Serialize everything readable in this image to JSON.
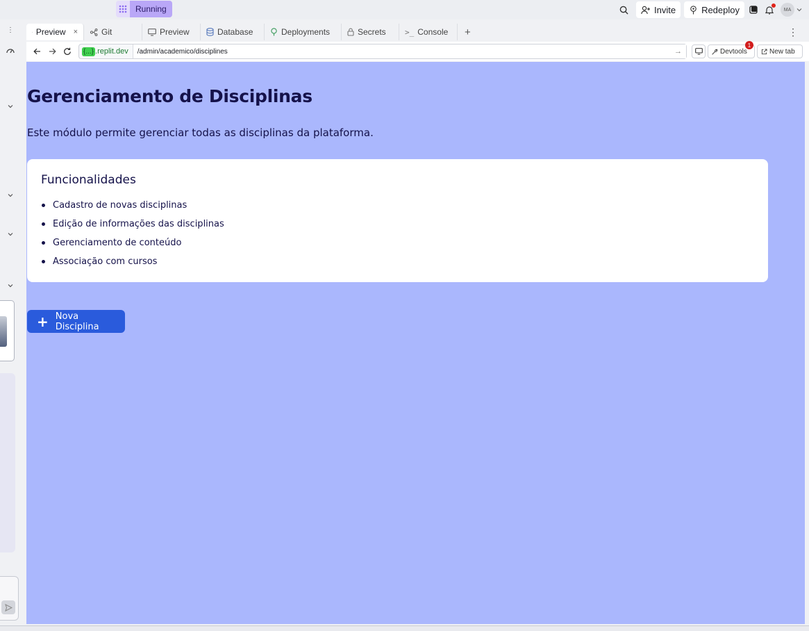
{
  "topbar": {
    "running_label": "Running",
    "invite_label": "Invite",
    "redeploy_label": "Redeploy",
    "avatar_initials": "MA"
  },
  "tabs": [
    {
      "label": "Preview",
      "icon": "monitor-icon",
      "active": true
    },
    {
      "label": "Git",
      "icon": "git-icon"
    },
    {
      "label": "Preview",
      "icon": "monitor-icon"
    },
    {
      "label": "Database",
      "icon": "database-icon"
    },
    {
      "label": "Deployments",
      "icon": "deploy-icon"
    },
    {
      "label": "Secrets",
      "icon": "lock-icon"
    },
    {
      "label": "Console",
      "icon": "terminal-icon"
    }
  ],
  "address": {
    "domain_prefix": "{...}",
    "domain": ".replit.dev",
    "path": "/admin/academico/disciplines",
    "devtools_label": "Devtools",
    "devtools_badge": "1",
    "newtab_label": "New tab"
  },
  "page": {
    "title": "Gerenciamento de Disciplinas",
    "description": "Este módulo permite gerenciar todas as disciplinas da plataforma.",
    "card_title": "Funcionalidades",
    "features": [
      "Cadastro de novas disciplinas",
      "Edição de informações das disciplinas",
      "Gerenciamento de conteúdo",
      "Associação com cursos"
    ],
    "new_button_label": "Nova Disciplina"
  },
  "colors": {
    "preview_bg": "#aab7fd",
    "primary_button": "#2a5bdc",
    "running_pill": "#b9a7f7",
    "heading": "#15124a"
  }
}
